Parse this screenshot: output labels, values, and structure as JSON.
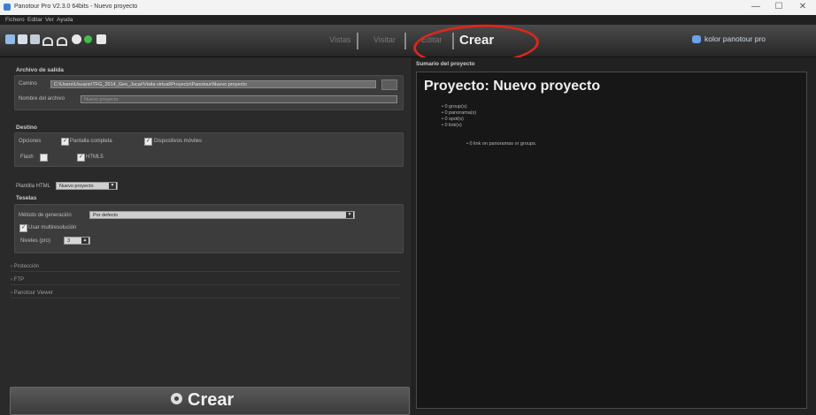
{
  "window": {
    "title": "Panotour Pro V2.3.0 64bits - Nuevo proyecto",
    "minimize": "—",
    "maximize": "☐",
    "close": "✕"
  },
  "menu": [
    "Fichero",
    "Editar",
    "Ver",
    "Ayuda"
  ],
  "toolbar": {
    "icons": [
      "search-icon",
      "save-icon",
      "save-as-icon",
      "undo-icon",
      "redo-icon",
      "settings-icon",
      "add-icon",
      "window-icon"
    ],
    "steps": [
      "Vistas",
      "Visitar",
      "Editar"
    ],
    "active_step": "Crear",
    "brand": "kolor panotour pro"
  },
  "left": {
    "output": {
      "title": "Archivo de salida",
      "path_label": "Camino",
      "path_value": "C:\\Users\\Usuario\\TFG_2014_Geo_Jucar\\Visita virtual\\Proyecto\\Panotour\\Nuevo proyecto",
      "name_label": "Nombre del archivo",
      "name_value": "Nuevo proyecto"
    },
    "target": {
      "title": "Destino",
      "options_label": "Opciones",
      "opt1": "Pantalla completa",
      "opt2": "Dispositivos móviles",
      "flash_label": "Flash",
      "html5_label": "HTML5"
    },
    "html_template": {
      "label": "Plantilla HTML",
      "value": "Nuevo proyecto"
    },
    "tiles": {
      "title": "Teselas",
      "method_label": "Método de generación",
      "method_value": "Por defecto",
      "multires_label": "Usar multiresolución",
      "levels_label": "Niveles (pro)",
      "levels_value": "3"
    },
    "collapsed": [
      "Protección",
      "FTP",
      "Panotour Viewer"
    ],
    "create_button": "Crear"
  },
  "right": {
    "title": "Sumario del proyecto",
    "project_title": "Proyecto: Nuevo proyecto",
    "stats": [
      "• 0 group(s)",
      "• 0 panorama(s)",
      "• 0 spot(s)",
      "• 0 link(s)"
    ],
    "note": "• 0 link on panoramas or groups."
  }
}
